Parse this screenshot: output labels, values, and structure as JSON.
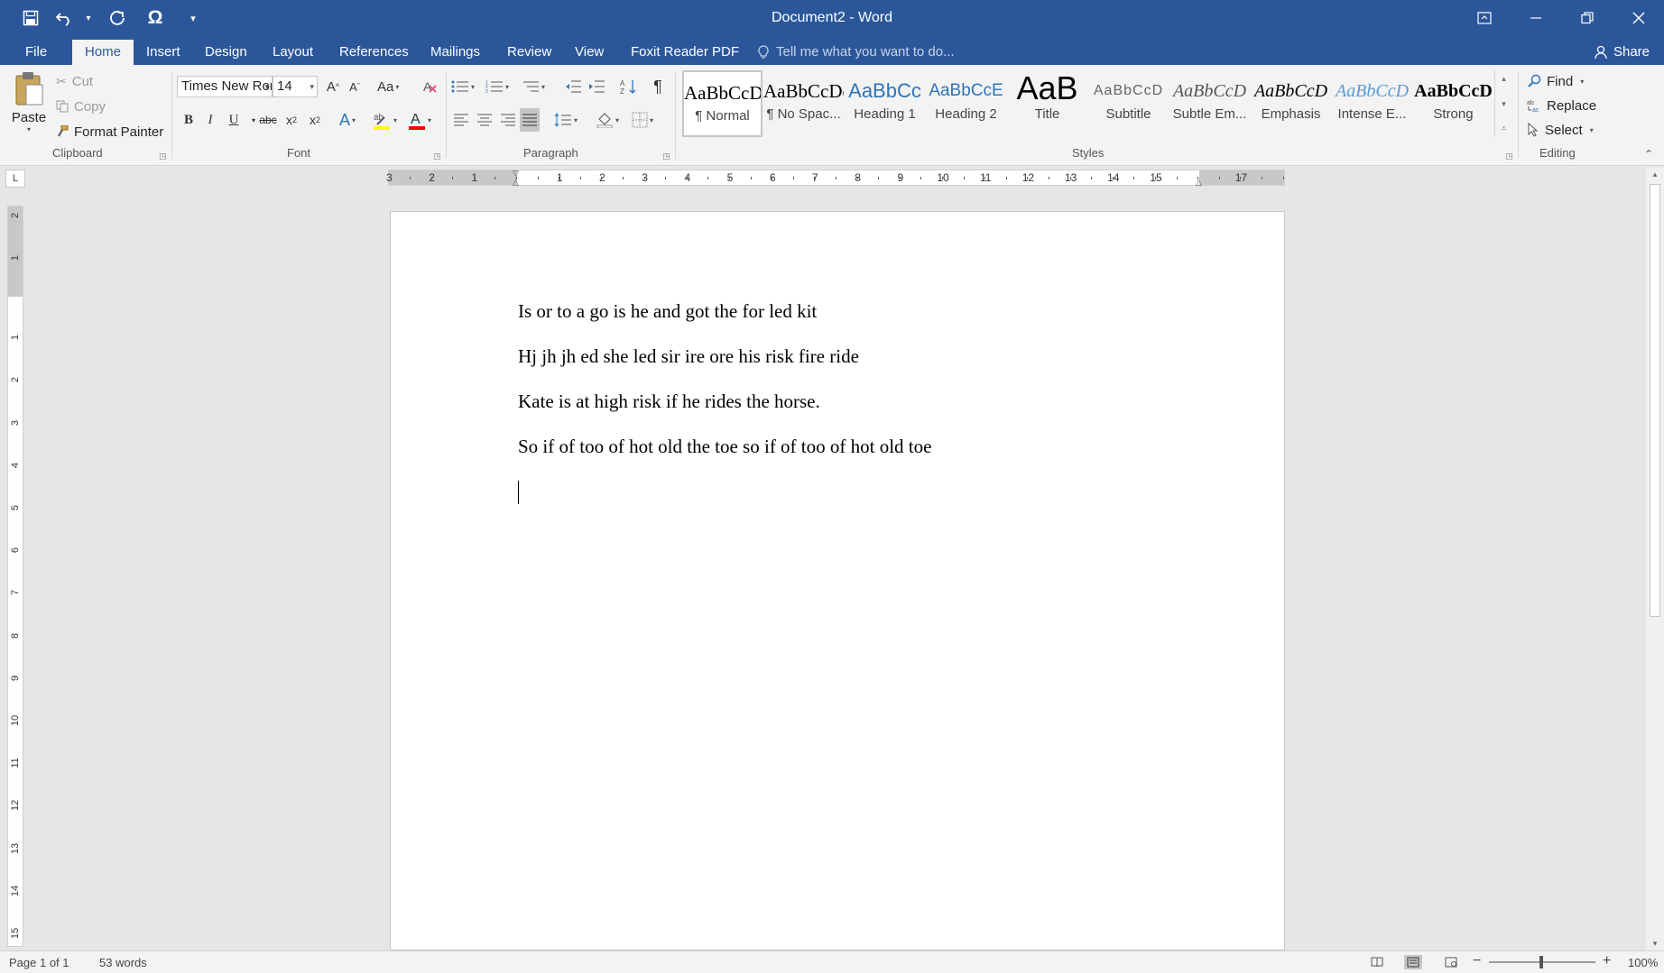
{
  "window": {
    "title": "Document2 - Word",
    "controls": [
      "ribbon-display-options",
      "minimize",
      "restore",
      "close"
    ]
  },
  "qat": {
    "items": [
      "save-icon",
      "undo-icon",
      "redo-icon",
      "omega-icon",
      "customize-caret"
    ]
  },
  "tabs": {
    "file": "File",
    "home": "Home",
    "insert": "Insert",
    "design": "Design",
    "layout": "Layout",
    "references": "References",
    "mailings": "Mailings",
    "review": "Review",
    "view": "View",
    "foxit": "Foxit Reader PDF",
    "tellme": "Tell me what you want to do...",
    "share": "Share"
  },
  "clipboard": {
    "label": "Clipboard",
    "paste": "Paste",
    "cut": "Cut",
    "copy": "Copy",
    "format_painter": "Format Painter"
  },
  "font": {
    "label": "Font",
    "name": "Times New Roman",
    "size": "14",
    "bold": "B",
    "italic": "I",
    "underline": "U",
    "strike": "abc",
    "change_case": "Aa"
  },
  "paragraph": {
    "label": "Paragraph"
  },
  "styles": {
    "label": "Styles",
    "items": [
      {
        "sample": "AaBbCcDc",
        "name": "¶ Normal"
      },
      {
        "sample": "AaBbCcDc",
        "name": "¶ No Spac..."
      },
      {
        "sample": "AaBbCc",
        "name": "Heading 1"
      },
      {
        "sample": "AaBbCcE",
        "name": "Heading 2"
      },
      {
        "sample": "AaB",
        "name": "Title"
      },
      {
        "sample": "AaBbCcD",
        "name": "Subtitle"
      },
      {
        "sample": "AaBbCcD",
        "name": "Subtle Em..."
      },
      {
        "sample": "AaBbCcD",
        "name": "Emphasis"
      },
      {
        "sample": "AaBbCcD",
        "name": "Intense E..."
      },
      {
        "sample": "AaBbCcD",
        "name": "Strong"
      }
    ]
  },
  "editing": {
    "label": "Editing",
    "find": "Find",
    "replace": "Replace",
    "select": "Select"
  },
  "ruler": {
    "corner": "L",
    "h_numbers": [
      "3",
      "2",
      "1",
      "1",
      "2",
      "3",
      "4",
      "5",
      "6",
      "7",
      "8",
      "9",
      "10",
      "11",
      "12",
      "13",
      "14",
      "15",
      "17"
    ],
    "v_numbers": [
      "2",
      "1",
      "1",
      "2",
      "3",
      "4",
      "5",
      "6",
      "7",
      "8",
      "9",
      "10",
      "11",
      "12",
      "13",
      "14",
      "15"
    ]
  },
  "document": {
    "paragraphs": [
      "Is or to a go is he and got the for led kit",
      "Hj jh jh ed she led sir ire ore his risk fire ride",
      "Kate is at high risk if he rides the horse.",
      "So if of too of hot old the toe so if of too of hot old toe"
    ]
  },
  "status": {
    "page": "Page 1 of 1",
    "words": "53 words",
    "zoom": "100%",
    "zoom_minus": "−",
    "zoom_plus": "+"
  },
  "colors": {
    "title_bar": "#2b579a",
    "highlight": "#ffff00",
    "font_color": "#ff0000"
  }
}
